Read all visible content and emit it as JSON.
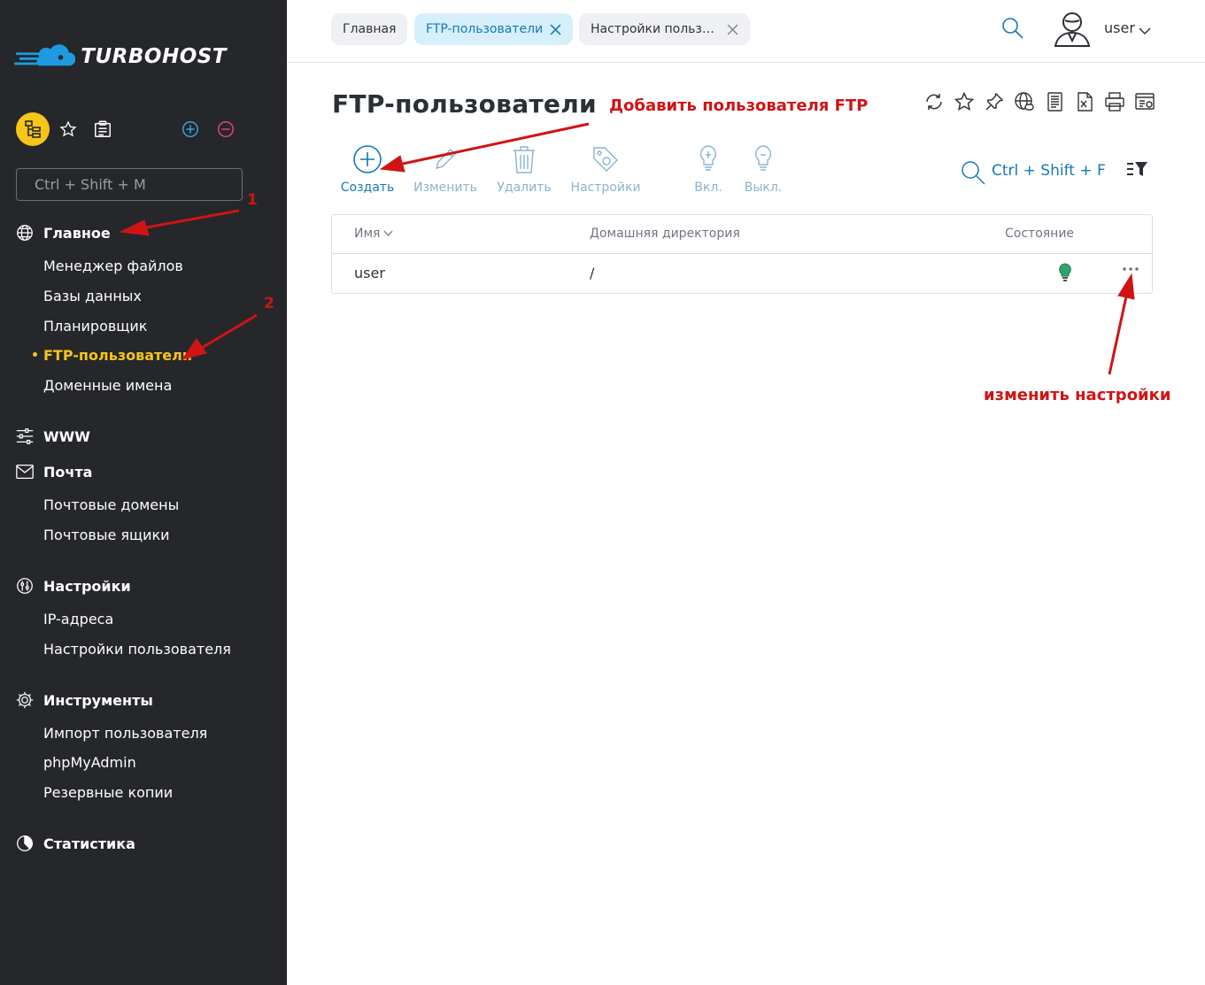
{
  "brand": {
    "name": "TURBOHOST"
  },
  "sidebar": {
    "search_placeholder": "Ctrl + Shift + M",
    "groups": [
      {
        "label": "Главное",
        "items": [
          "Менеджер файлов",
          "Базы данных",
          "Планировщик",
          "FTP-пользователи",
          "Доменные имена"
        ]
      },
      {
        "label": "WWW",
        "items": []
      },
      {
        "label": "Почта",
        "items": [
          "Почтовые домены",
          "Почтовые ящики"
        ]
      },
      {
        "label": "Настройки",
        "items": [
          "IP-адреса",
          "Настройки пользователя"
        ]
      },
      {
        "label": "Инструменты",
        "items": [
          "Импорт пользователя",
          "phpMyAdmin",
          "Резервные копии"
        ]
      },
      {
        "label": "Статистика",
        "items": []
      }
    ],
    "active_item": "FTP-пользователи"
  },
  "tabs": [
    {
      "label": "Главная",
      "closable": false,
      "active": false
    },
    {
      "label": "FTP-пользователи",
      "closable": true,
      "active": true
    },
    {
      "label": "Настройки польз…",
      "closable": true,
      "active": false
    }
  ],
  "header": {
    "user": "user"
  },
  "page": {
    "title": "FTP-пользователи"
  },
  "toolbar": {
    "create": "Создать",
    "edit": "Изменить",
    "delete": "Удалить",
    "settings": "Настройки",
    "enable": "Вкл.",
    "disable": "Выкл.",
    "filter_hint": "Ctrl + Shift + F"
  },
  "table": {
    "columns": [
      "Имя",
      "Домашняя директория",
      "Состояние"
    ],
    "rows": [
      {
        "name": "user",
        "home": "/",
        "state": "on"
      }
    ]
  },
  "annotations": {
    "add_user": "Добавить пользователя FTP",
    "edit_settings": "изменить настройки",
    "step1": "1",
    "step2": "2"
  },
  "colors": {
    "sidebar_bg": "#25272b",
    "accent_yellow": "#f5c518",
    "link_blue": "#1479b8",
    "annotation_red": "#d01414"
  }
}
